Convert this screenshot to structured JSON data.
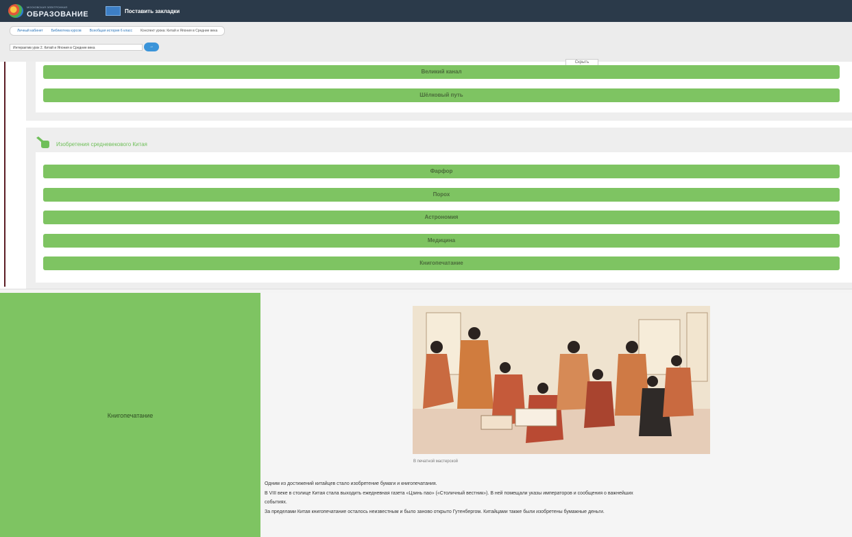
{
  "header": {
    "logo_small": "МОСКОВСКАЯ ЭЛЕКТРОННАЯ",
    "logo_text": "ОБРАЗОВАНИЕ",
    "bookmark_label": "Поставить закладки"
  },
  "breadcrumbs": [
    "Личный кабинет",
    "Библиотека курсов",
    "Всеобщая история 6 класс",
    "Конспект урока: Китай и Япония в Средние века"
  ],
  "lesson_select": {
    "value": "Интерактив урок 2. Китай и Япония в Средние века"
  },
  "go_button": "→",
  "hide_label": "Скрыть",
  "panel1": {
    "buttons": [
      "Великий канал",
      "Шёлковый путь"
    ]
  },
  "panel2": {
    "title": "Изобретения средневекового Китая",
    "buttons": [
      "Фарфор",
      "Порох",
      "Астрономия",
      "Медицина",
      "Книгопечатание"
    ]
  },
  "detail": {
    "side_label": "Книгопечатание",
    "image_caption": "В печатной мастерской",
    "paragraphs": [
      "Одним из достижений китайцев стало изобретение бумаги и книгопечатания.",
      "В VIII веке в столице Китая стала выходить ежедневная газета «Цзинь пао» («Столичный вестник»). В ней помещали указы императоров и сообщения о важнейших",
      "событиях.",
      "За пределами Китая книгопечатание осталось неизвестным и было заново открыто Гутенбергом. Китайцами также были изобретены бумажные деньги."
    ]
  },
  "colors": {
    "accent_green": "#7ec462",
    "header_dark": "#2b3a4a",
    "link_blue": "#2a74b8"
  }
}
